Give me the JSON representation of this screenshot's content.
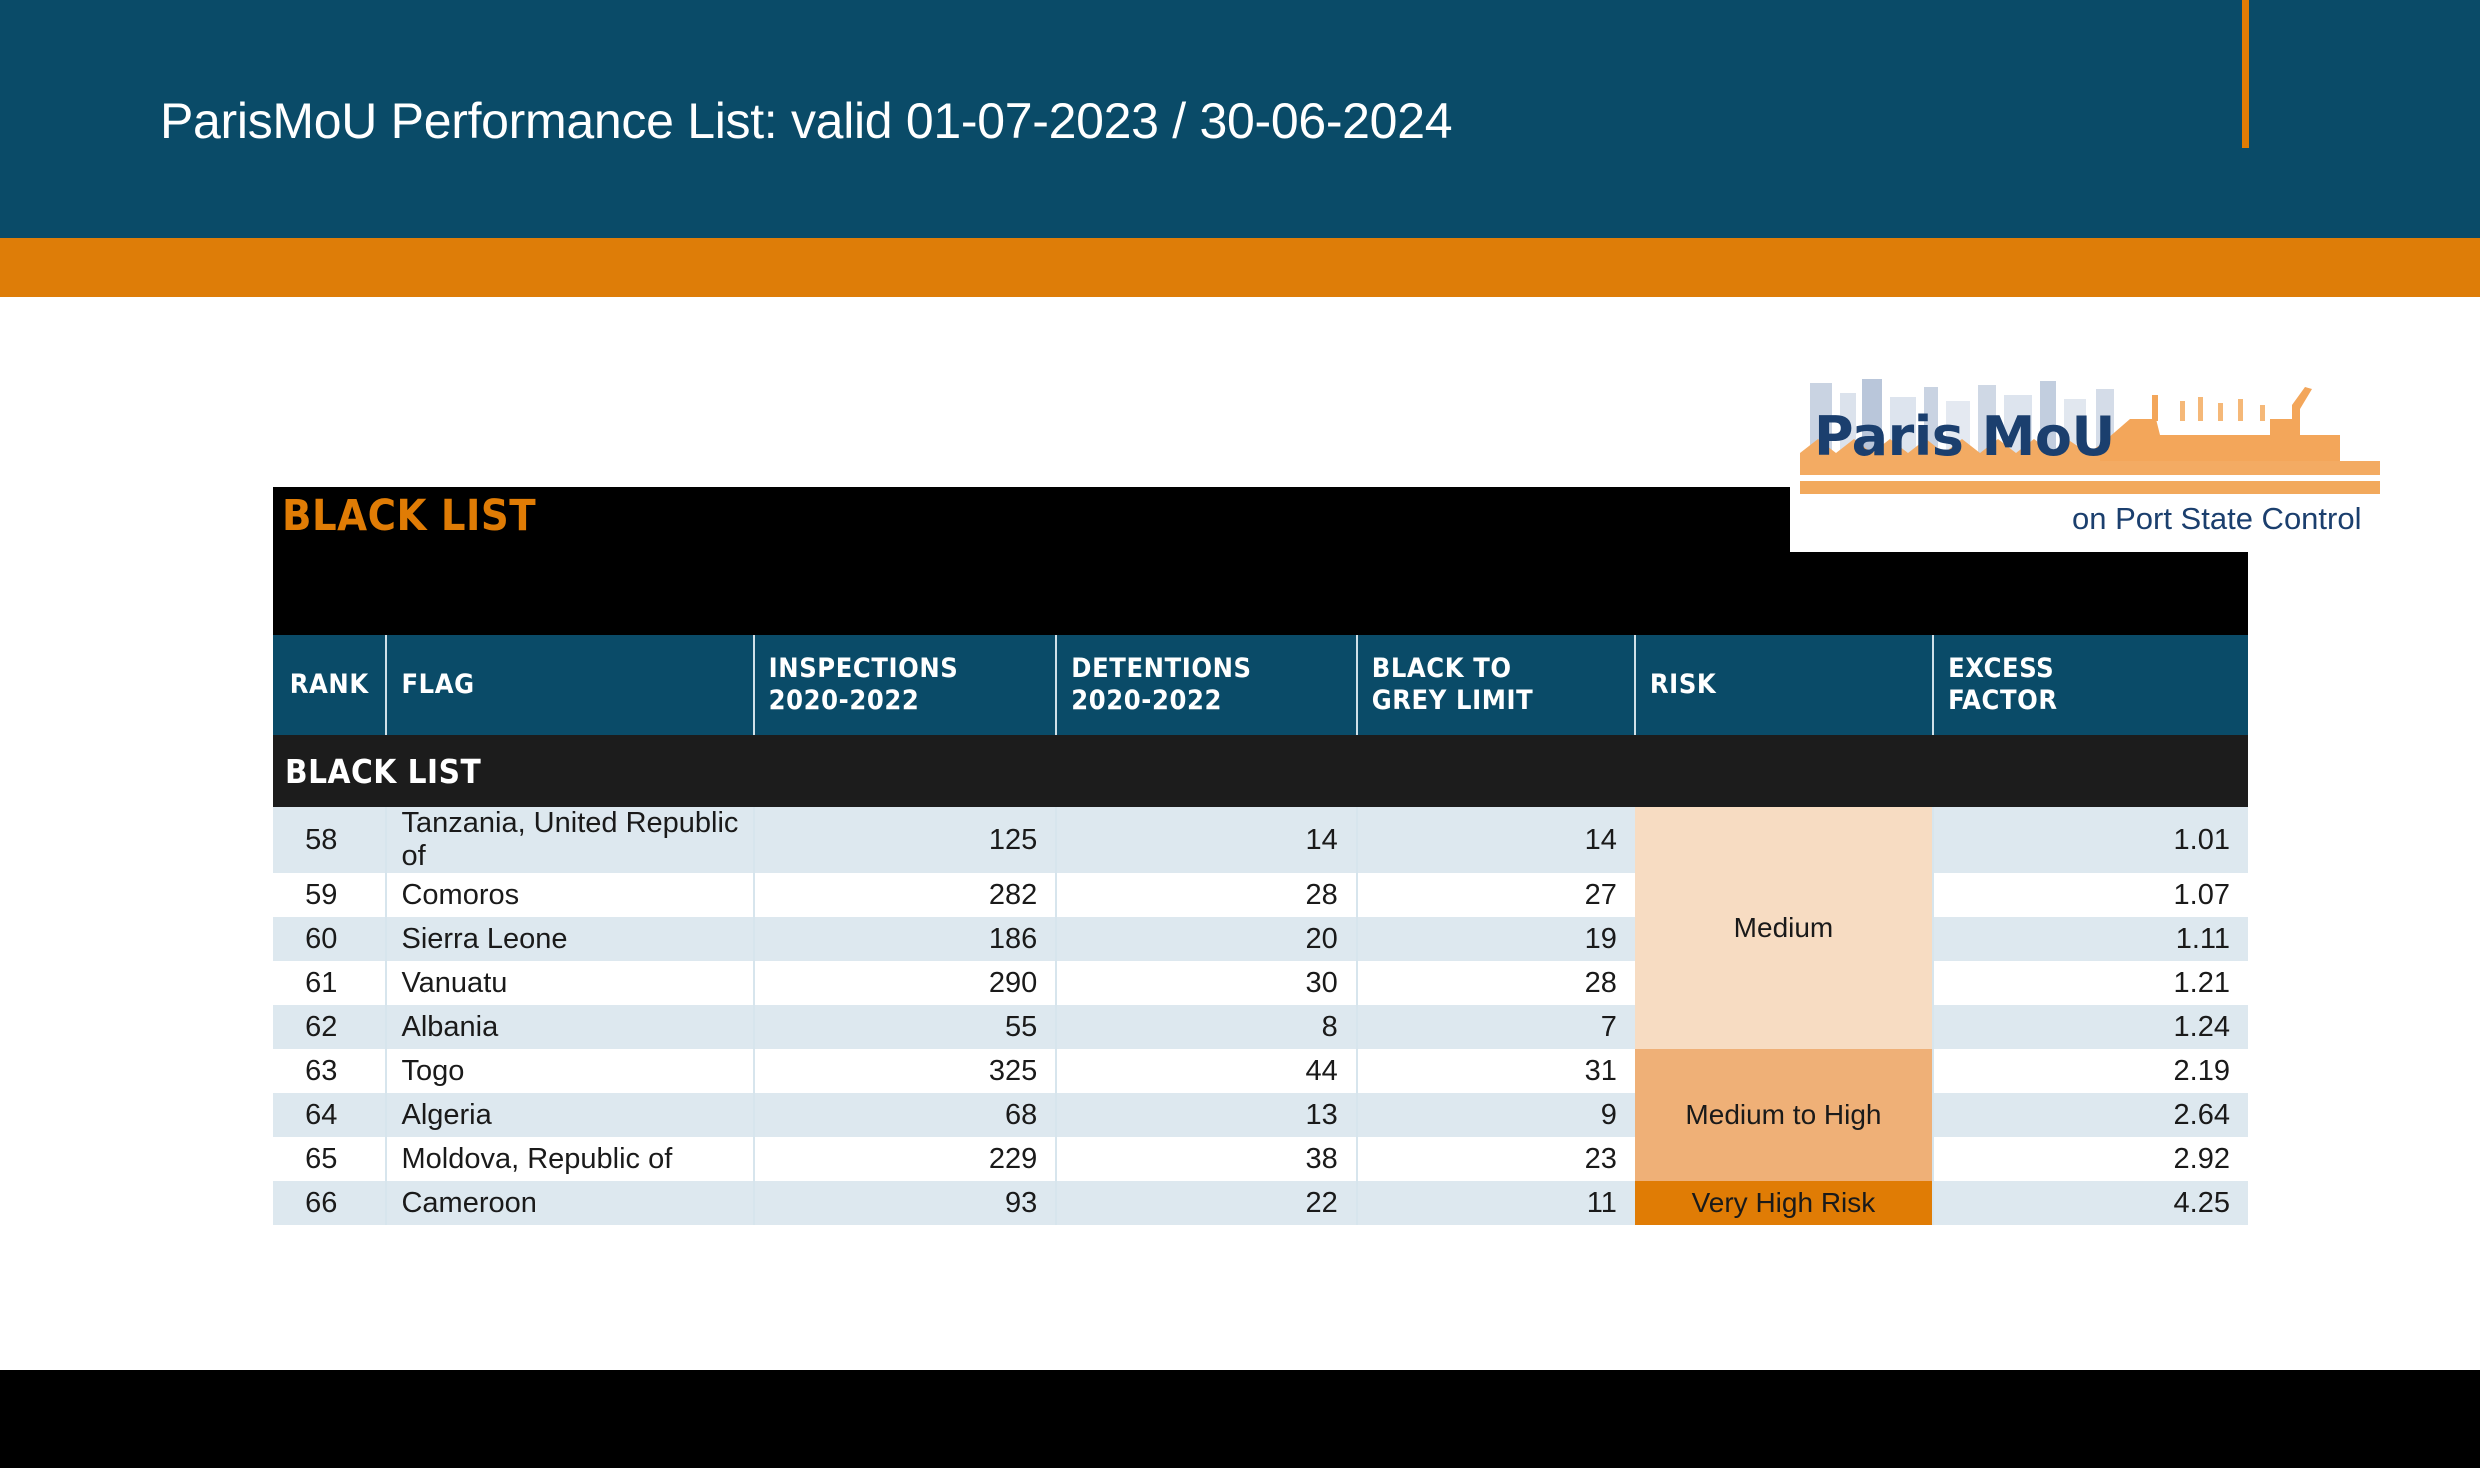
{
  "header": {
    "title": "ParisMoU Performance List: valid 01-07-2023 / 30-06-2024"
  },
  "logo": {
    "wordmark": "Paris MoU",
    "subtitle": "on Port State Control"
  },
  "list_title": "BLACK LIST",
  "table": {
    "columns": [
      "RANK",
      "FLAG",
      "INSPECTIONS 2020-2022",
      "DETENTIONS 2020-2022",
      "BLACK TO GREY LIMIT",
      "RISK",
      "EXCESS FACTOR"
    ],
    "columns_split": [
      {
        "line1": "RANK",
        "line2": ""
      },
      {
        "line1": "FLAG",
        "line2": ""
      },
      {
        "line1": "INSPECTIONS",
        "line2": "2020-2022"
      },
      {
        "line1": "DETENTIONS",
        "line2": "2020-2022"
      },
      {
        "line1": "BLACK TO",
        "line2": "GREY LIMIT"
      },
      {
        "line1": "RISK",
        "line2": ""
      },
      {
        "line1": "EXCESS",
        "line2": "FACTOR"
      }
    ],
    "section_label": "BLACK LIST",
    "rows": [
      {
        "rank": "58",
        "flag": "Tanzania, United Republic of",
        "inspections": "125",
        "detentions": "14",
        "black_to_grey_limit": "14",
        "excess_factor": "1.01"
      },
      {
        "rank": "59",
        "flag": "Comoros",
        "inspections": "282",
        "detentions": "28",
        "black_to_grey_limit": "27",
        "excess_factor": "1.07"
      },
      {
        "rank": "60",
        "flag": "Sierra Leone",
        "inspections": "186",
        "detentions": "20",
        "black_to_grey_limit": "19",
        "excess_factor": "1.11"
      },
      {
        "rank": "61",
        "flag": "Vanuatu",
        "inspections": "290",
        "detentions": "30",
        "black_to_grey_limit": "28",
        "excess_factor": "1.21"
      },
      {
        "rank": "62",
        "flag": "Albania",
        "inspections": "55",
        "detentions": "8",
        "black_to_grey_limit": "7",
        "excess_factor": "1.24"
      },
      {
        "rank": "63",
        "flag": "Togo",
        "inspections": "325",
        "detentions": "44",
        "black_to_grey_limit": "31",
        "excess_factor": "2.19"
      },
      {
        "rank": "64",
        "flag": "Algeria",
        "inspections": "68",
        "detentions": "13",
        "black_to_grey_limit": "9",
        "excess_factor": "2.64"
      },
      {
        "rank": "65",
        "flag": "Moldova, Republic of",
        "inspections": "229",
        "detentions": "38",
        "black_to_grey_limit": "23",
        "excess_factor": "2.92"
      },
      {
        "rank": "66",
        "flag": "Cameroon",
        "inspections": "93",
        "detentions": "22",
        "black_to_grey_limit": "11",
        "excess_factor": "4.25"
      }
    ],
    "risk_groups": [
      {
        "label": "Medium",
        "rowspan": 5,
        "color": "#f7dcc2"
      },
      {
        "label": "Medium to High",
        "rowspan": 3,
        "color": "#efb077"
      },
      {
        "label": "Very High Risk",
        "rowspan": 1,
        "color": "#e07c05"
      }
    ]
  },
  "colors": {
    "banner_blue": "#0a4b68",
    "accent_orange": "#de7d08",
    "black": "#000000",
    "row_alt": "#dde8ef"
  }
}
